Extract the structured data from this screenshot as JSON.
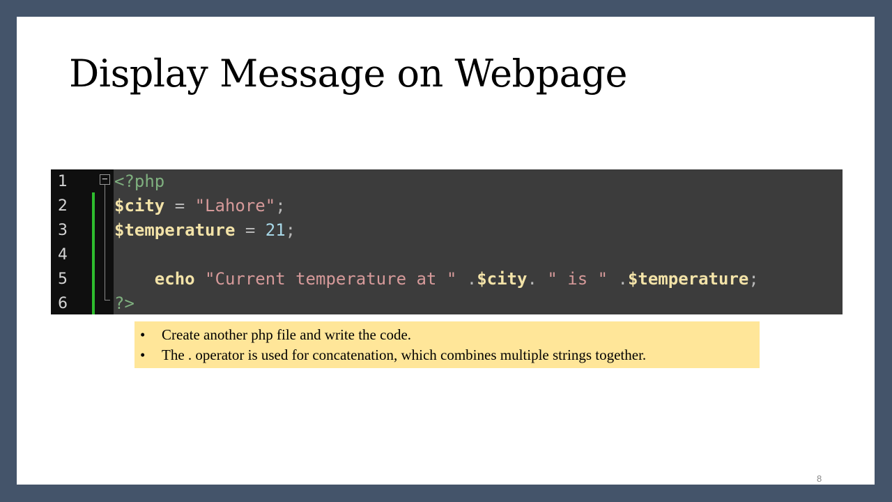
{
  "slide": {
    "title": "Display Message on Webpage",
    "page_number": "8"
  },
  "code": {
    "line_numbers": [
      "1",
      "2",
      "3",
      "4",
      "5",
      "6"
    ],
    "lines": [
      [
        {
          "t": "<?php",
          "c": "tag"
        }
      ],
      [
        {
          "t": "$city",
          "c": "var"
        },
        {
          "t": " = ",
          "c": "op"
        },
        {
          "t": "\"Lahore\"",
          "c": "str"
        },
        {
          "t": ";",
          "c": "op"
        }
      ],
      [
        {
          "t": "$temperature",
          "c": "var"
        },
        {
          "t": " = ",
          "c": "op"
        },
        {
          "t": "21",
          "c": "num"
        },
        {
          "t": ";",
          "c": "op"
        }
      ],
      [],
      [
        {
          "t": "    ",
          "c": "op"
        },
        {
          "t": "echo",
          "c": "kw"
        },
        {
          "t": " ",
          "c": "op"
        },
        {
          "t": "\"Current temperature at \"",
          "c": "str"
        },
        {
          "t": " .",
          "c": "op"
        },
        {
          "t": "$city",
          "c": "var"
        },
        {
          "t": ". ",
          "c": "op"
        },
        {
          "t": "\" is \"",
          "c": "str"
        },
        {
          "t": " .",
          "c": "op"
        },
        {
          "t": "$temperature",
          "c": "var"
        },
        {
          "t": ";",
          "c": "op"
        }
      ],
      [
        {
          "t": "?>",
          "c": "tag"
        }
      ]
    ],
    "fold_icon": "minus-box-icon",
    "colors": {
      "background": "#3c3c3c",
      "gutter": "#0f0f0f",
      "change_bar": "#2ebd2e"
    }
  },
  "notes": {
    "items": [
      "Create another php file and write the code.",
      "The . operator is used for concatenation, which combines multiple strings together."
    ],
    "bullet": "•",
    "background": "#ffe699"
  },
  "frame_color": "#44546a"
}
